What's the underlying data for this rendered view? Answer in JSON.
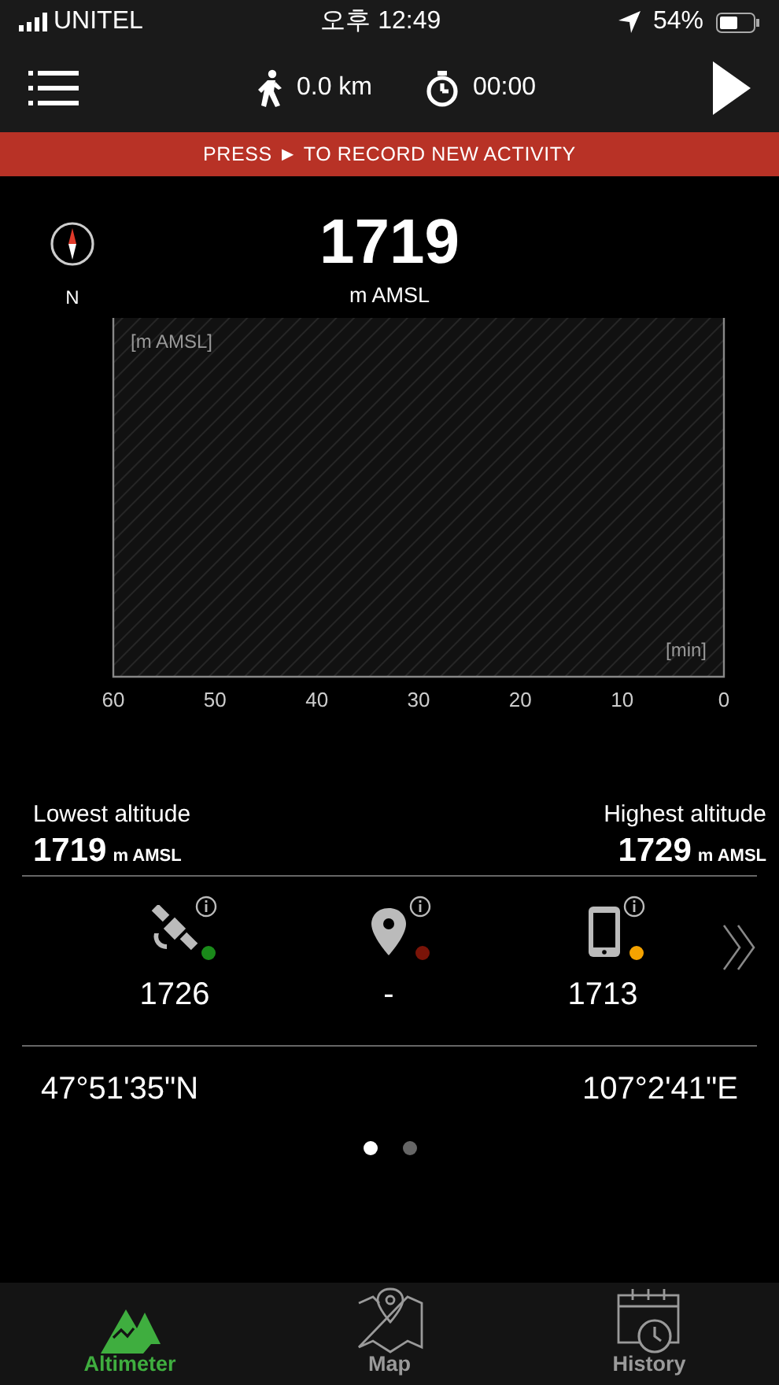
{
  "status_bar": {
    "carrier": "UNITEL",
    "time": "오후 12:49",
    "battery": "54%"
  },
  "toolbar": {
    "distance": "0.0 km",
    "duration": "00:00"
  },
  "banner": {
    "before": "PRESS",
    "symbol": "►",
    "after": "TO RECORD NEW ACTIVITY"
  },
  "compass": {
    "direction": "N"
  },
  "altitude": {
    "value": "1719",
    "unit": "m AMSL"
  },
  "chart": {
    "y_label": "[m AMSL]",
    "x_label": "[min]",
    "x_ticks": [
      "60",
      "50",
      "40",
      "30",
      "20",
      "10",
      "0"
    ]
  },
  "stats": [
    {
      "label": "Lowest altitude",
      "value": "1719",
      "unit": "m AMSL"
    },
    {
      "label": "Highest altitude",
      "value": "1729",
      "unit": "m AMSL"
    }
  ],
  "sources": [
    {
      "kind": "gps",
      "color": "#1a8a1a",
      "value": "1726"
    },
    {
      "kind": "location",
      "color": "#7a1408",
      "value": "-"
    },
    {
      "kind": "phone",
      "color": "#f5a300",
      "value": "1713"
    }
  ],
  "coordinates": {
    "latitude": "47°51'35\"N",
    "longitude": "107°2'41\"E"
  },
  "pages": [
    {
      "selected": true
    },
    {
      "selected": false
    }
  ],
  "tabs": [
    {
      "kind": "altimeter",
      "label": "Altimeter",
      "selected": true
    },
    {
      "kind": "map",
      "label": "Map",
      "selected": false
    },
    {
      "kind": "history",
      "label": "History",
      "selected": false
    }
  ]
}
